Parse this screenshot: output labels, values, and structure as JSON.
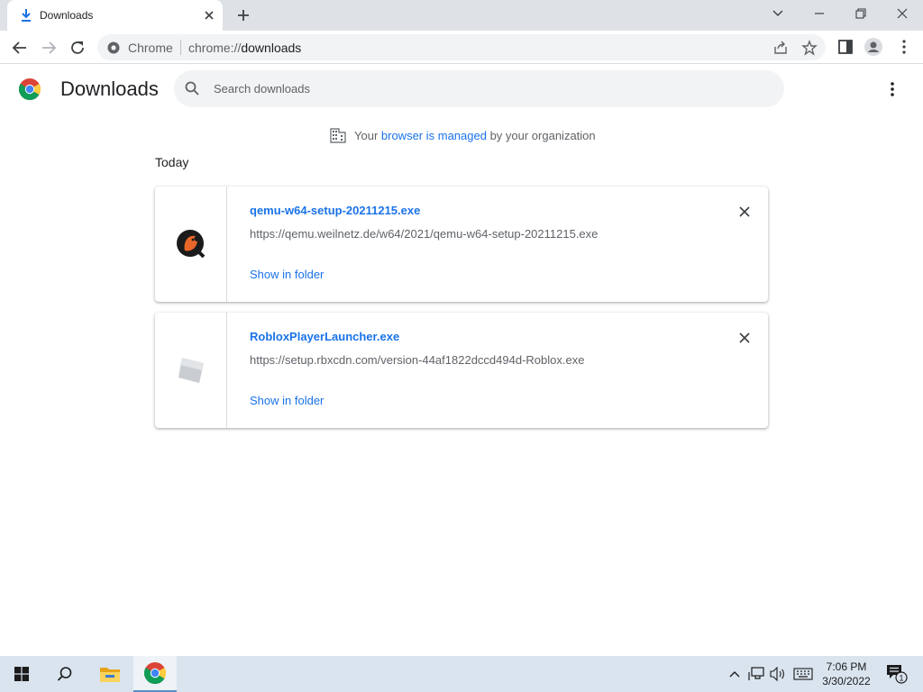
{
  "tab": {
    "title": "Downloads",
    "icon": "download-icon"
  },
  "window_controls": [
    "chevron-down-icon",
    "minimize-icon",
    "restore-icon",
    "close-icon"
  ],
  "omnibox": {
    "site_label": "Chrome",
    "url_scheme": "chrome://",
    "url_host": "downloads"
  },
  "page": {
    "title": "Downloads",
    "search_placeholder": "Search downloads",
    "managed": {
      "prefix": "Your ",
      "link": "browser is managed",
      "suffix": " by your organization"
    },
    "date_header": "Today"
  },
  "downloads": [
    {
      "file_name": "qemu-w64-setup-20211215.exe",
      "url": "https://qemu.weilnetz.de/w64/2021/qemu-w64-setup-20211215.exe",
      "action": "Show in folder",
      "icon": "qemu-app-icon"
    },
    {
      "file_name": "RobloxPlayerLauncher.exe",
      "url": "https://setup.rbxcdn.com/version-44af1822dccd494d-Roblox.exe",
      "action": "Show in folder",
      "icon": "roblox-app-icon"
    }
  ],
  "taskbar": {
    "clock_time": "7:06 PM",
    "clock_date": "3/30/2022",
    "notification_count": "1",
    "colors": {
      "background": "#d9e4ef",
      "accent": "#1a73e8"
    }
  }
}
